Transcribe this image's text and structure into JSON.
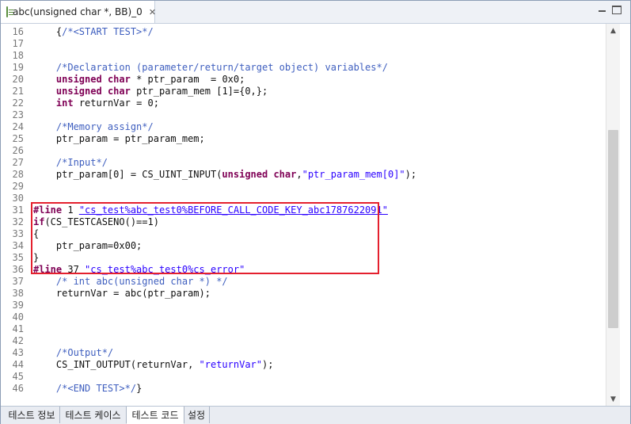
{
  "tab": {
    "title": "abc(unsigned char *, BB)_0",
    "close_glyph": "✕"
  },
  "window_controls": {
    "minimize_icon": "minimize-icon",
    "maximize_icon": "maximize-icon"
  },
  "bottom_tabs": [
    "테스트 정보",
    "테스트 케이스",
    "테스트 코드",
    "설정"
  ],
  "active_bottom_tab": "테스트 코드",
  "scroll": {
    "up": "▲",
    "down": "▼"
  },
  "colors": {
    "highlight_border": "#e4202e",
    "keyword": "#7f0055",
    "comment": "#3f5fbf",
    "string": "#2a00ff"
  },
  "lines": [
    {
      "num": "16",
      "segments": [
        {
          "t": "    {"
        },
        {
          "t": "/*<START TEST>*/",
          "c": "cm"
        }
      ]
    },
    {
      "num": "17",
      "segments": []
    },
    {
      "num": "18",
      "segments": []
    },
    {
      "num": "19",
      "segments": [
        {
          "t": "    "
        },
        {
          "t": "/*Declaration (parameter/return/target object) variables*/",
          "c": "cm"
        }
      ]
    },
    {
      "num": "20",
      "segments": [
        {
          "t": "    "
        },
        {
          "t": "unsigned",
          "c": "kw"
        },
        {
          "t": " "
        },
        {
          "t": "char",
          "c": "kw"
        },
        {
          "t": " * ptr_param  = 0x0;"
        }
      ]
    },
    {
      "num": "21",
      "segments": [
        {
          "t": "    "
        },
        {
          "t": "unsigned",
          "c": "kw"
        },
        {
          "t": " "
        },
        {
          "t": "char",
          "c": "kw"
        },
        {
          "t": " ptr_param_mem [1]={0,};"
        }
      ]
    },
    {
      "num": "22",
      "segments": [
        {
          "t": "    "
        },
        {
          "t": "int",
          "c": "kw"
        },
        {
          "t": " returnVar = 0;"
        }
      ]
    },
    {
      "num": "23",
      "segments": []
    },
    {
      "num": "24",
      "segments": [
        {
          "t": "    "
        },
        {
          "t": "/*Memory assign*/",
          "c": "cm"
        }
      ]
    },
    {
      "num": "25",
      "segments": [
        {
          "t": "    ptr_param = ptr_param_mem;"
        }
      ]
    },
    {
      "num": "26",
      "segments": []
    },
    {
      "num": "27",
      "segments": [
        {
          "t": "    "
        },
        {
          "t": "/*Input*/",
          "c": "cm"
        }
      ]
    },
    {
      "num": "28",
      "segments": [
        {
          "t": "    ptr_param[0] = CS_UINT_INPUT("
        },
        {
          "t": "unsigned",
          "c": "kw"
        },
        {
          "t": " "
        },
        {
          "t": "char",
          "c": "kw"
        },
        {
          "t": ","
        },
        {
          "t": "\"ptr_param_mem[0]\"",
          "c": "str"
        },
        {
          "t": ");"
        }
      ]
    },
    {
      "num": "29",
      "segments": []
    },
    {
      "num": "30",
      "segments": []
    },
    {
      "num": "31",
      "segments": [
        {
          "t": "#line",
          "c": "pp"
        },
        {
          "t": " 1 "
        },
        {
          "t": "\"cs_test%abc_test0%BEFORE_CALL_CODE_KEY_abc1787622091\"",
          "c": "str und"
        }
      ]
    },
    {
      "num": "32",
      "segments": [
        {
          "t": "if",
          "c": "kw"
        },
        {
          "t": "(CS_TESTCASENO()==1)"
        }
      ]
    },
    {
      "num": "33",
      "segments": [
        {
          "t": "{"
        }
      ]
    },
    {
      "num": "34",
      "segments": [
        {
          "t": "    ptr_param=0x00;"
        }
      ]
    },
    {
      "num": "35",
      "segments": [
        {
          "t": "}"
        }
      ]
    },
    {
      "num": "36",
      "segments": [
        {
          "t": "#line",
          "c": "pp"
        },
        {
          "t": " 37 "
        },
        {
          "t": "\"cs_test%abc_test0%cs_error\"",
          "c": "str und"
        }
      ]
    },
    {
      "num": "37",
      "segments": [
        {
          "t": "    "
        },
        {
          "t": "/* int abc(unsigned char *) */",
          "c": "cm"
        }
      ]
    },
    {
      "num": "38",
      "segments": [
        {
          "t": "    returnVar = abc(ptr_param);"
        }
      ]
    },
    {
      "num": "39",
      "segments": []
    },
    {
      "num": "40",
      "segments": []
    },
    {
      "num": "41",
      "segments": []
    },
    {
      "num": "42",
      "segments": []
    },
    {
      "num": "43",
      "segments": [
        {
          "t": "    "
        },
        {
          "t": "/*Output*/",
          "c": "cm"
        }
      ]
    },
    {
      "num": "44",
      "segments": [
        {
          "t": "    CS_INT_OUTPUT(returnVar, "
        },
        {
          "t": "\"returnVar\"",
          "c": "str"
        },
        {
          "t": ");"
        }
      ]
    },
    {
      "num": "45",
      "segments": []
    },
    {
      "num": "46",
      "segments": [
        {
          "t": "    "
        },
        {
          "t": "/*<END TEST>*/",
          "c": "cm"
        },
        {
          "t": "}"
        }
      ]
    }
  ]
}
